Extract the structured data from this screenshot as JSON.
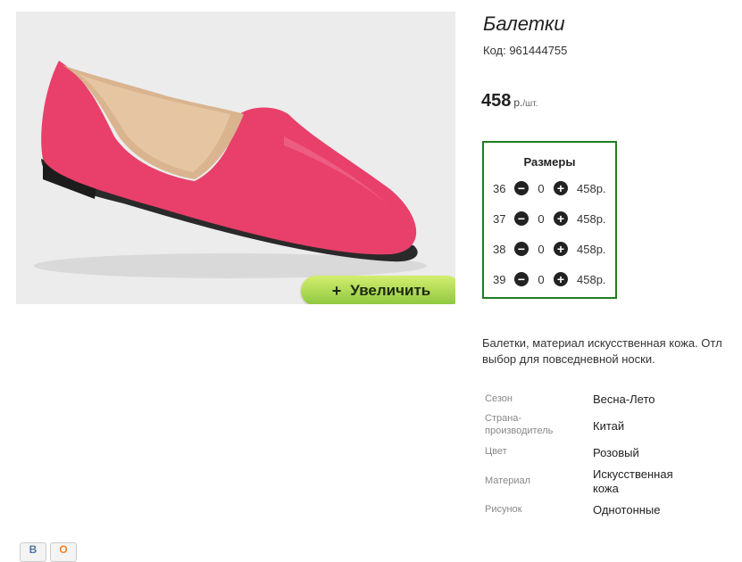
{
  "product": {
    "title": "Балетки",
    "code_label": "Код: 961444755",
    "price": "458",
    "price_unit": "р.",
    "price_per": "/шт."
  },
  "image": {
    "zoom_label": "Увеличить",
    "zoom_icon": "+",
    "shoe_color": "#e8406a"
  },
  "sizes": {
    "header": "Размеры",
    "rows": [
      {
        "size": "36",
        "qty": "0",
        "price": "458р."
      },
      {
        "size": "37",
        "qty": "0",
        "price": "458р."
      },
      {
        "size": "38",
        "qty": "0",
        "price": "458р."
      },
      {
        "size": "39",
        "qty": "0",
        "price": "458р."
      }
    ]
  },
  "description": {
    "line1": "Балетки, материал искусственная кожа. Отл",
    "line2": "выбор для повседневной носки."
  },
  "properties": [
    {
      "key": "Сезон",
      "value": "Весна-Лето"
    },
    {
      "key": "Страна-производитель",
      "key_line1": "Страна-",
      "key_line2": "производитель",
      "value": "Китай"
    },
    {
      "key": "Цвет",
      "value": "Розовый"
    },
    {
      "key": "Материал",
      "value": "Искусственная кожа",
      "value_line1": "Искусственная",
      "value_line2": "кожа"
    },
    {
      "key": "Рисунок",
      "value": "Однотонные"
    }
  ],
  "social": {
    "vk": "В",
    "ok": "О"
  },
  "colors": {
    "accent_green": "#1f7d1f",
    "button_green": "#8cc63f"
  }
}
